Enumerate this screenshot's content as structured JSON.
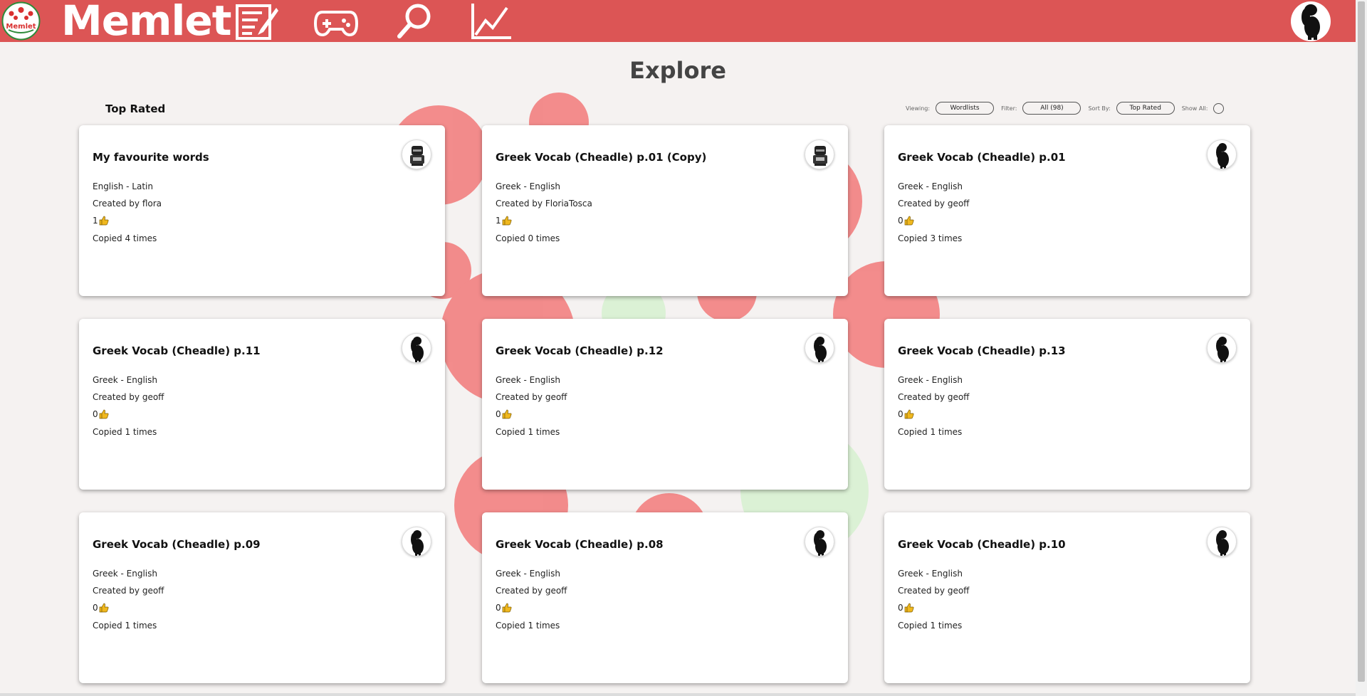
{
  "app": {
    "brand": "Memlet",
    "logo_text": "Memlet",
    "nav": [
      {
        "name": "edit-wordlist-icon"
      },
      {
        "name": "gamepad-icon"
      },
      {
        "name": "search-icon"
      },
      {
        "name": "stats-chart-icon"
      }
    ],
    "user_avatar": "poodle-avatar-icon"
  },
  "page": {
    "title": "Explore",
    "section_title": "Top Rated"
  },
  "controls": {
    "viewing_label": "Viewing:",
    "viewing_value": "Wordlists",
    "filter_label": "Filter:",
    "filter_value": "All (98)",
    "sort_label": "Sort By:",
    "sort_value": "Top Rated",
    "show_all_label": "Show All:",
    "show_all_on": false
  },
  "cards": [
    {
      "title": "My favourite words",
      "lang": "English - Latin",
      "creator": "Created by flora",
      "likes": "1",
      "copied": "Copied 4 times",
      "avatar": "knight-avatar-icon"
    },
    {
      "title": "Greek Vocab (Cheadle) p.01 (Copy)",
      "lang": "Greek - English",
      "creator": "Created by FloriaTosca",
      "likes": "1",
      "copied": "Copied 0 times",
      "avatar": "knight-avatar-icon"
    },
    {
      "title": "Greek Vocab (Cheadle) p.01",
      "lang": "Greek - English",
      "creator": "Created by geoff",
      "likes": "0",
      "copied": "Copied 3 times",
      "avatar": "poodle-avatar-icon"
    },
    {
      "title": "Greek Vocab (Cheadle) p.11",
      "lang": "Greek - English",
      "creator": "Created by geoff",
      "likes": "0",
      "copied": "Copied 1 times",
      "avatar": "poodle-avatar-icon"
    },
    {
      "title": "Greek Vocab (Cheadle) p.12",
      "lang": "Greek - English",
      "creator": "Created by geoff",
      "likes": "0",
      "copied": "Copied 1 times",
      "avatar": "poodle-avatar-icon"
    },
    {
      "title": "Greek Vocab (Cheadle) p.13",
      "lang": "Greek - English",
      "creator": "Created by geoff",
      "likes": "0",
      "copied": "Copied 1 times",
      "avatar": "poodle-avatar-icon"
    },
    {
      "title": "Greek Vocab (Cheadle) p.09",
      "lang": "Greek - English",
      "creator": "Created by geoff",
      "likes": "0",
      "copied": "Copied 1 times",
      "avatar": "poodle-avatar-icon"
    },
    {
      "title": "Greek Vocab (Cheadle) p.08",
      "lang": "Greek - English",
      "creator": "Created by geoff",
      "likes": "0",
      "copied": "Copied 1 times",
      "avatar": "poodle-avatar-icon"
    },
    {
      "title": "Greek Vocab (Cheadle) p.10",
      "lang": "Greek - English",
      "creator": "Created by geoff",
      "likes": "0",
      "copied": "Copied 1 times",
      "avatar": "poodle-avatar-icon"
    }
  ],
  "colors": {
    "nav_bg": "#dc5555",
    "page_bg": "#f5f2f1",
    "blob_red": "#f27a7a",
    "blob_green": "#d8f1d2",
    "thumb": "#f0b81e"
  }
}
